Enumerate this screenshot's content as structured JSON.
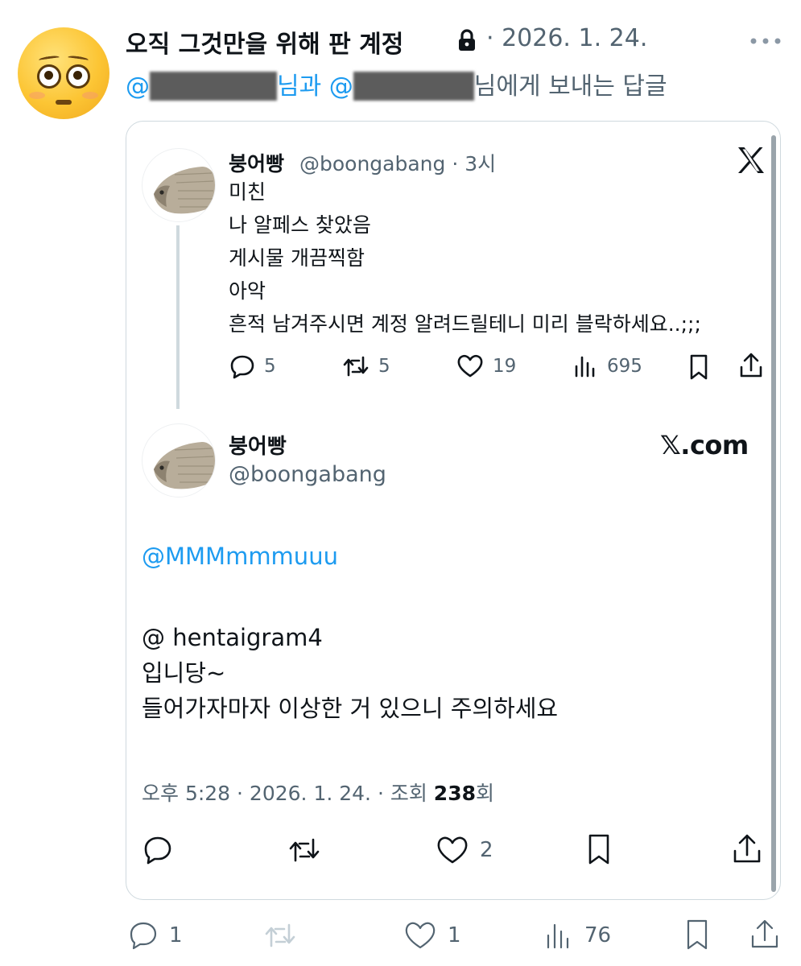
{
  "tweet": {
    "display_name": "오직 그것만을 위해 판 계정",
    "date": "· 2026. 1. 24.",
    "reply_prefix_at_1": "@",
    "reply_suffix_1": "님과 ",
    "reply_prefix_at_2": "@",
    "reply_suffix_2": "님에게 보내는 답글",
    "actions": {
      "replies": "1",
      "reposts": "",
      "likes": "1",
      "views": "76"
    }
  },
  "quoted_post": {
    "name": "붕어빵",
    "handle_time": "@boongabang · 3시",
    "lines": [
      "미친",
      "나 알페스 찾았음",
      "게시물 개끔찍함",
      "아악",
      "흔적 남겨주시면 계정 알려드릴테니 미리 블락하세요..;;;"
    ],
    "actions": {
      "replies": "5",
      "reposts": "5",
      "likes": "19",
      "views": "695"
    }
  },
  "reply_post": {
    "name": "붕어빵",
    "handle": "@boongabang",
    "brand": "𝕏.com",
    "mention": "@MMMmmmuuu",
    "lines": [
      "@ hentaigram4",
      "입니당~",
      "들어가자마자 이상한 거 있으니 주의하세요"
    ],
    "meta_prefix": "오후 5:28 · 2026. 1. 24. · 조회 ",
    "meta_views": "238",
    "meta_suffix": "회",
    "actions": {
      "likes": "2"
    }
  }
}
